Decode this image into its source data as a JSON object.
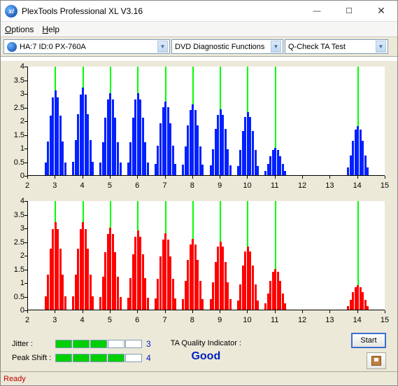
{
  "window": {
    "title": "PlexTools Professional XL V3.16",
    "minimize": "—",
    "maximize": "☐",
    "close": "✕"
  },
  "menu": {
    "options": "Options",
    "help": "Help"
  },
  "toolbar": {
    "device": "HA:7 ID:0   PX-760A",
    "func": "DVD Diagnostic Functions",
    "test": "Q-Check TA Test"
  },
  "chart": {
    "ymin": 0,
    "ymax": 4,
    "ystep": 0.5,
    "xmin": 2,
    "xmax": 15,
    "yticks": [
      "0",
      "0.5",
      "1",
      "1.5",
      "2",
      "2.5",
      "3",
      "3.5",
      "4"
    ],
    "xticks": [
      "2",
      "3",
      "4",
      "5",
      "6",
      "7",
      "8",
      "9",
      "10",
      "11",
      "12",
      "13",
      "14",
      "15"
    ]
  },
  "chart_data": [
    {
      "type": "bar",
      "color": "#0020ff",
      "vlines_at": [
        3,
        4,
        5,
        6,
        7,
        8,
        9,
        10,
        11,
        14
      ],
      "groups": [
        {
          "center": 3,
          "peak": 3.1
        },
        {
          "center": 4,
          "peak": 3.2
        },
        {
          "center": 5,
          "peak": 3.0
        },
        {
          "center": 6,
          "peak": 3.0
        },
        {
          "center": 7,
          "peak": 2.7
        },
        {
          "center": 8,
          "peak": 2.6
        },
        {
          "center": 9,
          "peak": 2.4
        },
        {
          "center": 10,
          "peak": 2.3
        },
        {
          "center": 11,
          "peak": 1.0
        },
        {
          "center": 14,
          "peak": 1.8
        }
      ]
    },
    {
      "type": "bar",
      "color": "#ff0000",
      "vlines_at": [
        3,
        4,
        5,
        6,
        7,
        8,
        9,
        10,
        11,
        14
      ],
      "groups": [
        {
          "center": 3,
          "peak": 3.2
        },
        {
          "center": 4,
          "peak": 3.2
        },
        {
          "center": 5,
          "peak": 3.0
        },
        {
          "center": 6,
          "peak": 2.9
        },
        {
          "center": 7,
          "peak": 2.8
        },
        {
          "center": 8,
          "peak": 2.6
        },
        {
          "center": 9,
          "peak": 2.5
        },
        {
          "center": 10,
          "peak": 2.3
        },
        {
          "center": 11,
          "peak": 1.5
        },
        {
          "center": 14,
          "peak": 0.9
        }
      ]
    }
  ],
  "metrics": {
    "jitter_label": "Jitter :",
    "jitter_boxes": 5,
    "jitter_filled": 3,
    "jitter_value": "3",
    "peakshift_label": "Peak Shift :",
    "peakshift_boxes": 5,
    "peakshift_filled": 4,
    "peakshift_value": "4"
  },
  "quality": {
    "label": "TA Quality Indicator :",
    "value": "Good"
  },
  "buttons": {
    "start": "Start"
  },
  "status": {
    "text": "Ready"
  }
}
